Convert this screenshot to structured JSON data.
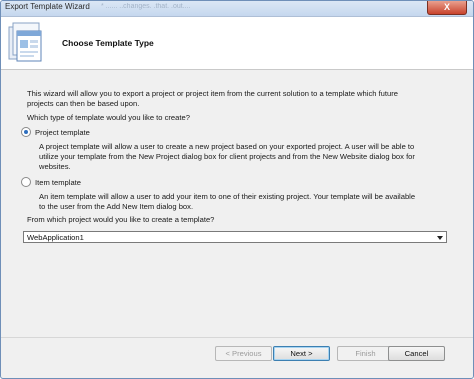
{
  "window": {
    "title": "Export Template Wizard",
    "ghost_text": "* ...... ..changes. .that. .out....",
    "close_glyph": "X"
  },
  "header": {
    "heading": "Choose Template Type"
  },
  "intro": {
    "line1": "This wizard will allow you to export a project or project item from the current solution to a template which future",
    "line2": "projects can then be based upon."
  },
  "question": "Which type of template would you like to create?",
  "options": [
    {
      "label": "Project template",
      "selected": true,
      "desc_lines": [
        "A project template will allow a user to create a new project based on your exported project. A user will be able to",
        "utilize your template from the New Project dialog box for client projects and from the New Website dialog box for",
        "websites."
      ]
    },
    {
      "label": "Item template",
      "selected": false,
      "desc_lines": [
        "An item template will allow a user to add your item to one of their existing project. Your template will be available",
        "to the user from the Add New Item dialog box."
      ]
    }
  ],
  "project_prompt": "From which project would you like to create a template?",
  "project_select": {
    "value": "WebApplication1"
  },
  "buttons": {
    "previous": "< Previous",
    "next": "Next >",
    "finish": "Finish",
    "cancel": "Cancel"
  },
  "colors": {
    "titlebar": "#c5d7ee",
    "dialog_bg": "#f0f0f0",
    "header_bg": "#ffffff",
    "close_button": "#c8432d"
  },
  "icons": {
    "wizard": "template-wizard-icon",
    "radio": "radio-button",
    "dropdown": "chevron-down-icon"
  }
}
